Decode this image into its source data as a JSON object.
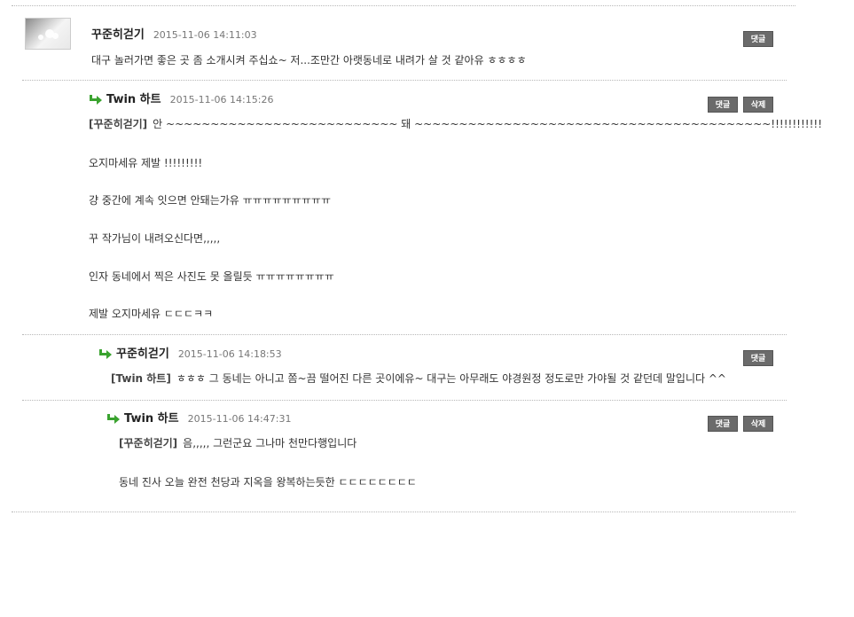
{
  "buttons": {
    "reply": "댓글",
    "delete": "삭제"
  },
  "comments": [
    {
      "author": "꾸준히걷기",
      "date": "2015-11-06 14:11:03",
      "lines": [
        "대구 놀러가면 좋은 곳 좀 소개시켜 주십쇼~ 저...조만간 아랫동네로 내려가 살 것 같아유 ㅎㅎㅎㅎ"
      ]
    },
    {
      "author": "Twin 하트",
      "date": "2015-11-06 14:15:26",
      "mention": "[꾸준히걷기]",
      "lines": [
        "안 ~~~~~~~~~~~~~~~~~~~~~~~~~~ 돼 ~~~~~~~~~~~~~~~~~~~~~~~~~~~~~~~~~~~~~~~~!!!!!!!!!!!!",
        "오지마세유 제발 !!!!!!!!!",
        "걍 중간에 계속 잇으면 안돼는가유 ㅠㅠㅠㅠㅠㅠㅠㅠㅠ",
        "꾸 작가님이 내려오신다면,,,,,",
        "인자 동네에서 찍은 사진도 못 올릴듯 ㅠㅠㅠㅠㅠㅠㅠㅠ",
        "제발 오지마세유 ㄷㄷㄷㅋㅋ"
      ]
    },
    {
      "author": "꾸준히걷기",
      "date": "2015-11-06 14:18:53",
      "mention": "[Twin 하트]",
      "lines": [
        "ㅎㅎㅎ 그 동네는 아니고 쫌~끔 떨어진 다른 곳이에유~ 대구는 아무래도 야경원정 정도로만 가야될 것 같던데 말입니다 ^^"
      ]
    },
    {
      "author": "Twin 하트",
      "date": "2015-11-06 14:47:31",
      "mention": "[꾸준히걷기]",
      "lines": [
        "음,,,,, 그런군요 그나마 천만다행입니다",
        "동네 진사 오늘 완전 천당과 지옥을 왕복하는듯한 ㄷㄷㄷㄷㄷㄷㄷㄷ"
      ]
    }
  ]
}
